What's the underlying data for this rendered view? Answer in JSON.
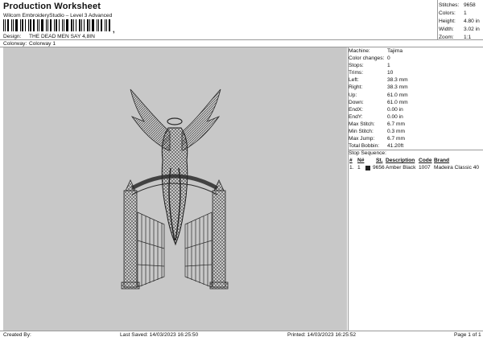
{
  "header": {
    "title": "Production Worksheet",
    "software": "Wilcom EmbroideryStudio – Level 3 Advanced",
    "barcode_suffix": ",",
    "design_label": "Design:",
    "design_value": "THE DEAD MEN SAY 4,8IN",
    "colorway_label": "Colorway:",
    "colorway_value": "Colorway 1"
  },
  "stats": [
    {
      "label": "Stitches:",
      "value": "9658"
    },
    {
      "label": "Colors:",
      "value": "1"
    },
    {
      "label": "Height:",
      "value": "4.80 in"
    },
    {
      "label": "Width:",
      "value": "3.02 in"
    },
    {
      "label": "Zoom:",
      "value": "1:1"
    }
  ],
  "machine_info": [
    {
      "label": "Machine:",
      "value": "Tajima"
    },
    {
      "label": "Color changes:",
      "value": "0"
    },
    {
      "label": "Stops:",
      "value": "1"
    },
    {
      "label": "Trims:",
      "value": "10"
    },
    {
      "label": "Left:",
      "value": "38.3 mm"
    },
    {
      "label": "Right:",
      "value": "38.3 mm"
    },
    {
      "label": "Up:",
      "value": "61.0 mm"
    },
    {
      "label": "Down:",
      "value": "61.0 mm"
    },
    {
      "label": "EndX:",
      "value": "0.00 in"
    },
    {
      "label": "EndY:",
      "value": "0.00 in"
    },
    {
      "label": "Max Stitch:",
      "value": "6.7 mm"
    },
    {
      "label": "Min Stitch:",
      "value": "0.3 mm"
    },
    {
      "label": "Max Jump:",
      "value": "6.7 mm"
    },
    {
      "label": "Total Bobbin:",
      "value": "41.20ft"
    }
  ],
  "stop_sequence": {
    "title": "Stop Sequence:",
    "columns": [
      "#",
      "N#",
      "St.",
      "Description",
      "Code",
      "Brand"
    ],
    "rows": [
      {
        "num": "1.",
        "n": "1",
        "stitches": "9656",
        "description": "Amber Black",
        "code": "1007",
        "brand": "Madeira Classic 40",
        "color": "#222222"
      }
    ]
  },
  "footer": {
    "created_by": "Created By:",
    "last_saved": "Last Saved: 14/03/2023 16:25:50",
    "printed": "Printed: 14/03/2023 16:25:52",
    "page": "Page 1 of 1"
  },
  "colors": {
    "canvas_bg": "#c8c8c8",
    "thread": "#2a2a2a"
  }
}
